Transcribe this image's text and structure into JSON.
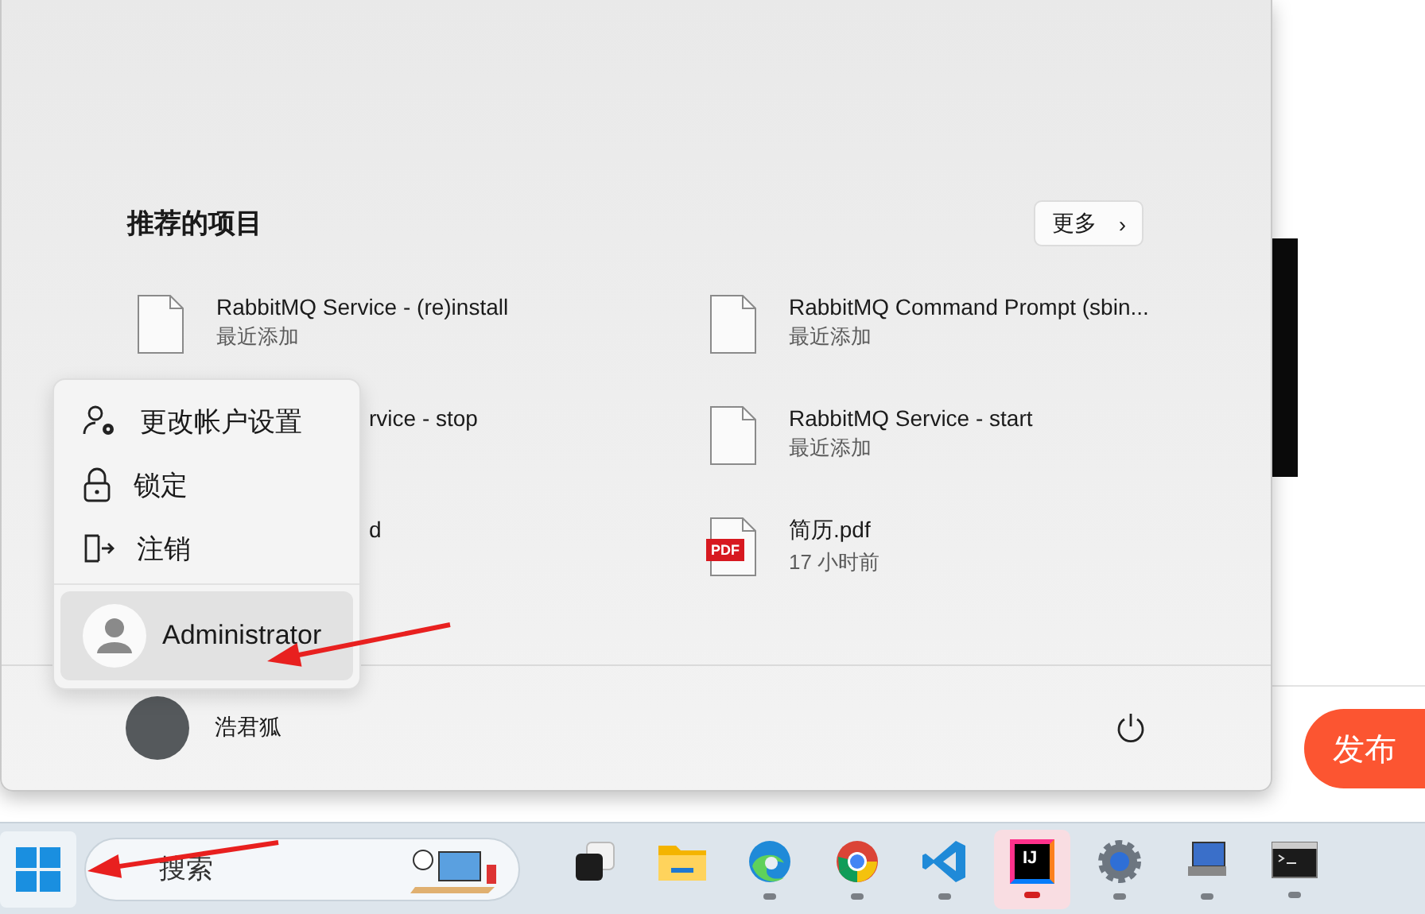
{
  "start_menu": {
    "recommended": {
      "title": "推荐的项目",
      "more_button": {
        "label": "更多",
        "chevron": "›"
      },
      "items": [
        {
          "kind": "file",
          "title": "RabbitMQ Service - (re)install",
          "subtitle": "最近添加"
        },
        {
          "kind": "file",
          "title": "RabbitMQ Command Prompt (sbin...",
          "subtitle": "最近添加"
        },
        {
          "kind": "covered",
          "title": "rvice - stop"
        },
        {
          "kind": "file",
          "title": "RabbitMQ Service - start",
          "subtitle": "最近添加"
        },
        {
          "kind": "covered",
          "title": "d"
        },
        {
          "kind": "pdf",
          "title": "简历.pdf",
          "subtitle": "17 小时前",
          "badge": "PDF"
        }
      ]
    },
    "user": {
      "name": "浩君狐"
    },
    "account_menu": {
      "items": [
        {
          "kind": "settings",
          "label": "更改帐户设置"
        },
        {
          "kind": "lock",
          "label": "锁定"
        },
        {
          "kind": "signout",
          "label": "注销"
        }
      ],
      "other_user": {
        "name": "Administrator",
        "selected": true
      }
    }
  },
  "background_page": {
    "publish_button": "发布"
  },
  "taskbar": {
    "start_selected": true,
    "search": {
      "placeholder": "搜索"
    },
    "apps": [
      {
        "kind": "taskview",
        "running": false,
        "selected": false
      },
      {
        "kind": "explorer",
        "running": false,
        "selected": false
      },
      {
        "kind": "edge",
        "running": true,
        "selected": false
      },
      {
        "kind": "chrome",
        "running": true,
        "selected": false
      },
      {
        "kind": "vscode",
        "running": true,
        "selected": false
      },
      {
        "kind": "intellij",
        "running": true,
        "selected": true,
        "label": "IJ"
      },
      {
        "kind": "gear",
        "running": true,
        "selected": false
      },
      {
        "kind": "remote",
        "running": true,
        "selected": false
      },
      {
        "kind": "terminal",
        "running": true,
        "selected": false
      }
    ]
  }
}
